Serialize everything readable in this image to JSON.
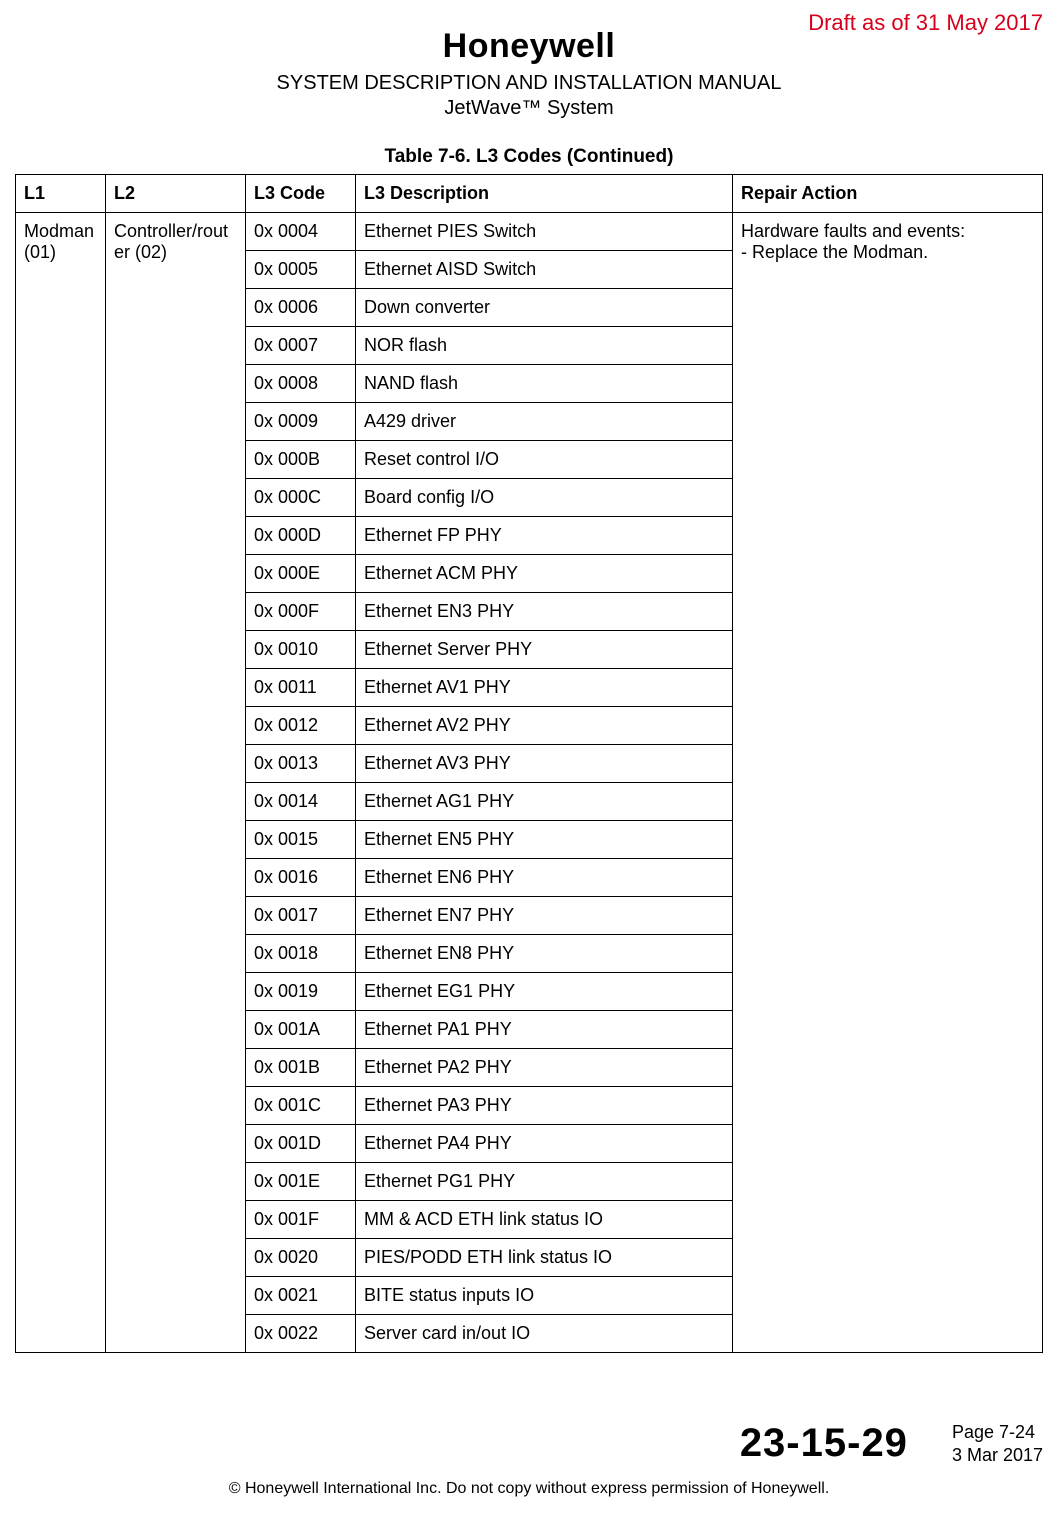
{
  "draft_notice": "Draft as of 31 May 2017",
  "brand": "Honeywell",
  "doc_title": "SYSTEM DESCRIPTION AND INSTALLATION MANUAL",
  "doc_subtitle": "JetWave™ System",
  "table_caption": "Table 7-6.   L3 Codes  (Continued)",
  "headers": {
    "l1": "L1",
    "l2": "L2",
    "code": "L3 Code",
    "desc": "L3 Description",
    "repair": "Repair Action"
  },
  "l1_cell": "Modman (01)",
  "l2_cell": "Controller/router (02)",
  "repair_cell": "Hardware faults and events:\n- Replace the Modman.",
  "rows": [
    {
      "code": "0x 0004",
      "desc": "Ethernet PIES Switch"
    },
    {
      "code": "0x 0005",
      "desc": "Ethernet AISD Switch"
    },
    {
      "code": "0x 0006",
      "desc": "Down converter"
    },
    {
      "code": "0x 0007",
      "desc": "NOR flash"
    },
    {
      "code": "0x 0008",
      "desc": "NAND flash"
    },
    {
      "code": "0x 0009",
      "desc": "A429 driver"
    },
    {
      "code": "0x 000B",
      "desc": "Reset control I/O"
    },
    {
      "code": "0x 000C",
      "desc": "Board config I/O"
    },
    {
      "code": "0x 000D",
      "desc": "Ethernet FP PHY"
    },
    {
      "code": "0x 000E",
      "desc": "Ethernet ACM PHY"
    },
    {
      "code": "0x 000F",
      "desc": "Ethernet EN3 PHY"
    },
    {
      "code": "0x 0010",
      "desc": "Ethernet Server PHY"
    },
    {
      "code": "0x 0011",
      "desc": "Ethernet AV1 PHY"
    },
    {
      "code": "0x 0012",
      "desc": "Ethernet AV2 PHY"
    },
    {
      "code": "0x 0013",
      "desc": "Ethernet AV3 PHY"
    },
    {
      "code": "0x 0014",
      "desc": "Ethernet AG1 PHY"
    },
    {
      "code": "0x 0015",
      "desc": "Ethernet EN5 PHY"
    },
    {
      "code": "0x 0016",
      "desc": "Ethernet EN6 PHY"
    },
    {
      "code": "0x 0017",
      "desc": "Ethernet EN7 PHY"
    },
    {
      "code": "0x 0018",
      "desc": "Ethernet EN8 PHY"
    },
    {
      "code": "0x 0019",
      "desc": "Ethernet EG1 PHY"
    },
    {
      "code": "0x 001A",
      "desc": "Ethernet PA1 PHY"
    },
    {
      "code": "0x 001B",
      "desc": "Ethernet PA2 PHY"
    },
    {
      "code": "0x 001C",
      "desc": "Ethernet PA3 PHY"
    },
    {
      "code": "0x 001D",
      "desc": "Ethernet PA4 PHY"
    },
    {
      "code": "0x 001E",
      "desc": "Ethernet PG1 PHY"
    },
    {
      "code": "0x 001F",
      "desc": "MM & ACD ETH link status IO"
    },
    {
      "code": "0x 0020",
      "desc": "PIES/PODD ETH link status IO"
    },
    {
      "code": "0x 0021",
      "desc": "BITE status inputs IO"
    },
    {
      "code": "0x 0022",
      "desc": "Server card in/out IO"
    }
  ],
  "doc_number": "23-15-29",
  "page_info": "Page 7-24",
  "page_date": "3 Mar 2017",
  "copyright": "© Honeywell International Inc. Do not copy without express permission of Honeywell."
}
